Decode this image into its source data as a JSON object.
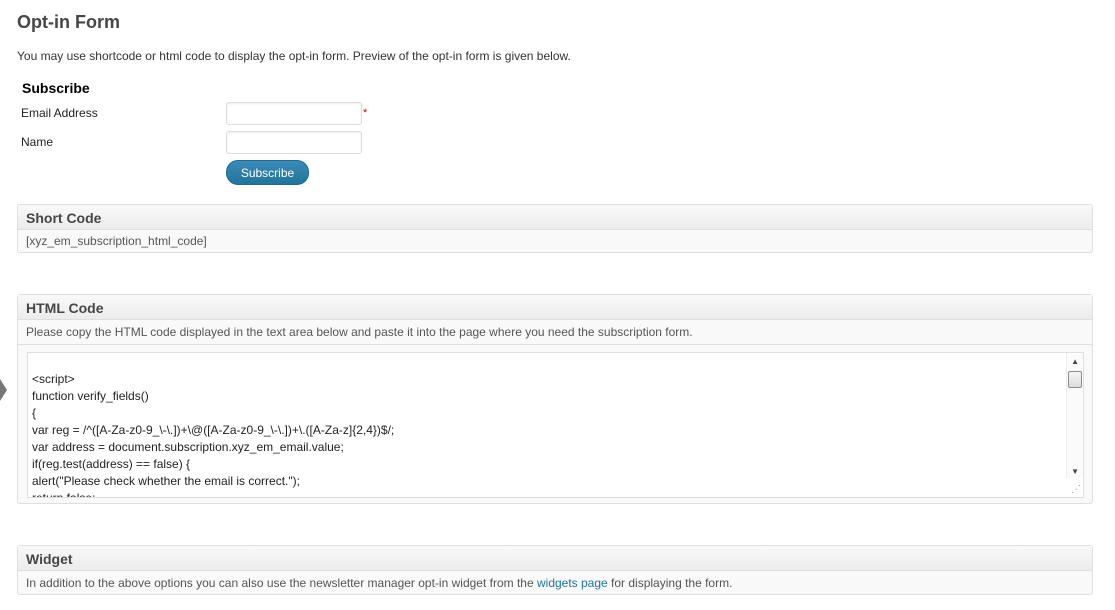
{
  "page": {
    "title": "Opt-in Form",
    "intro": "You may use shortcode or html code to display the opt-in form. Preview of the opt-in form is given below."
  },
  "form": {
    "heading": "Subscribe",
    "email_label": "Email Address",
    "email_value": "",
    "email_required_mark": "*",
    "name_label": "Name",
    "name_value": "",
    "subscribe_label": "Subscribe"
  },
  "short_code": {
    "title": "Short Code",
    "value": "[xyz_em_subscription_html_code]"
  },
  "html_code": {
    "title": "HTML Code",
    "description": "Please copy the HTML code displayed in the text area below and paste it into the page where you need the subscription form.",
    "lines": [
      "<script>",
      "function verify_fields()",
      "{",
      "var reg = /^([A-Za-z0-9_\\-\\.])+\\@([A-Za-z0-9_\\-\\.])+\\.([A-Za-z]{2,4})$/;",
      "var address = document.subscription.xyz_em_email.value;",
      "if(reg.test(address) == false) {",
      "alert(\"Please check whether the email is correct.\");",
      "return false;"
    ],
    "icons": {
      "scroll_up": "scroll-up-arrow-icon",
      "scroll_down": "scroll-down-arrow-icon",
      "resize": "resize-grip-icon"
    }
  },
  "widget": {
    "title": "Widget",
    "text_before": "In addition to the above options you can also use the newsletter manager opt-in widget from the ",
    "link_text": "widgets page",
    "text_after": " for displaying the form."
  },
  "colors": {
    "accent": "#21759b",
    "required": "#cc0000"
  }
}
